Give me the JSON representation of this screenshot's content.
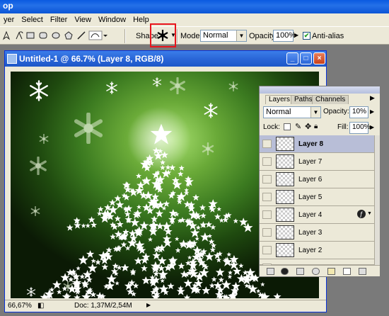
{
  "app": {
    "title_fragment": "op"
  },
  "menu": [
    "yer",
    "Select",
    "Filter",
    "View",
    "Window",
    "Help"
  ],
  "options": {
    "shape_label": "Shape:",
    "mode_label": "Mode:",
    "mode_value": "Normal",
    "opacity_label": "Opacity:",
    "opacity_value": "100%",
    "antialias_label": "Anti-alias",
    "antialias_checked": true,
    "highlight_color": "#e8141c"
  },
  "document": {
    "title": "Untitled-1 @ 66.7% (Layer 8, RGB/8)",
    "zoom": "66,67%",
    "doc_info": "Doc: 1,37M/2,54M"
  },
  "layers_panel": {
    "tabs": [
      "Layers",
      "Paths",
      "Channels"
    ],
    "active_tab": "Layers",
    "blend_mode": "Normal",
    "opacity_label": "Opacity:",
    "opacity_value": "10%",
    "lock_label": "Lock:",
    "fill_label": "Fill:",
    "fill_value": "100%",
    "layers": [
      {
        "name": "Layer 8",
        "selected": true
      },
      {
        "name": "Layer 7",
        "selected": false
      },
      {
        "name": "Layer 6",
        "selected": false
      },
      {
        "name": "Layer 5",
        "selected": false
      },
      {
        "name": "Layer 4",
        "selected": false,
        "has_effect": true
      },
      {
        "name": "Layer 3",
        "selected": false
      },
      {
        "name": "Layer 2",
        "selected": false
      }
    ]
  }
}
